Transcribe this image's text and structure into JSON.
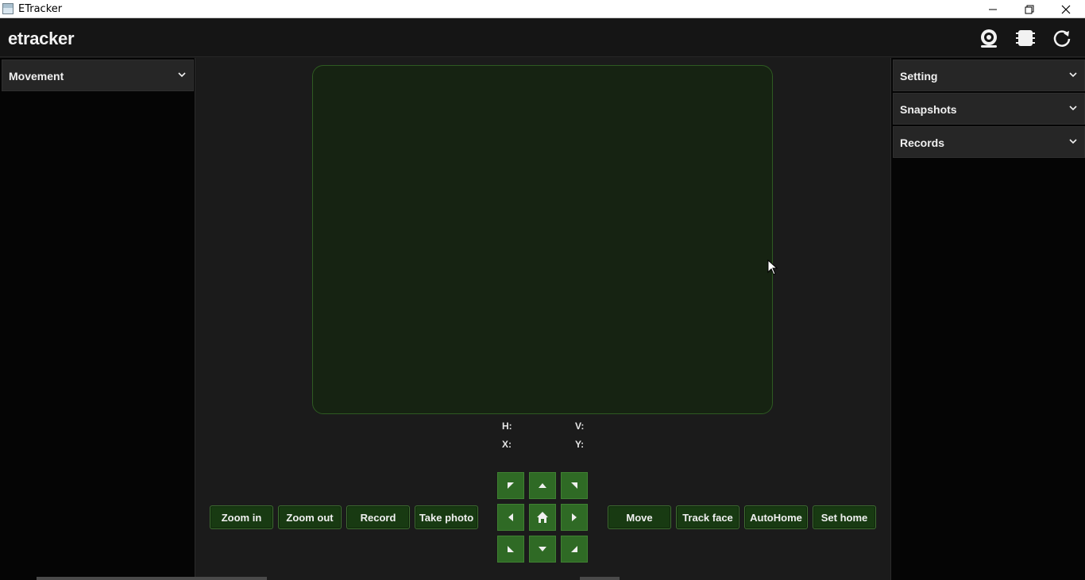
{
  "window": {
    "title": "ETracker",
    "controls": [
      "minimize",
      "restore",
      "close"
    ]
  },
  "header": {
    "logo": "etracker",
    "icons": [
      "webcam-icon",
      "chip-icon",
      "refresh-icon"
    ]
  },
  "left_panel": {
    "sections": [
      {
        "label": "Movement",
        "expanded": false
      }
    ]
  },
  "right_panel": {
    "sections": [
      {
        "label": "Setting",
        "expanded": false
      },
      {
        "label": "Snapshots",
        "expanded": false
      },
      {
        "label": "Records",
        "expanded": false
      }
    ]
  },
  "readout": {
    "h_label": "H:",
    "v_label": "V:",
    "x_label": "X:",
    "y_label": "Y:"
  },
  "actions_left": {
    "zoom_in": "Zoom in",
    "zoom_out": "Zoom out",
    "record": "Record",
    "take_photo": "Take photo"
  },
  "actions_right": {
    "move": "Move",
    "track_face": "Track face",
    "auto_home": "AutoHome",
    "set_home": "Set home"
  },
  "dpad": [
    "up-left",
    "up",
    "up-right",
    "left",
    "home",
    "right",
    "down-left",
    "down",
    "down-right"
  ],
  "colors": {
    "accent_green": "#2f6a25",
    "button_green": "#183a12",
    "frame_border": "#2e5a22",
    "background": "#1b1b1b",
    "panel": "#050505"
  }
}
